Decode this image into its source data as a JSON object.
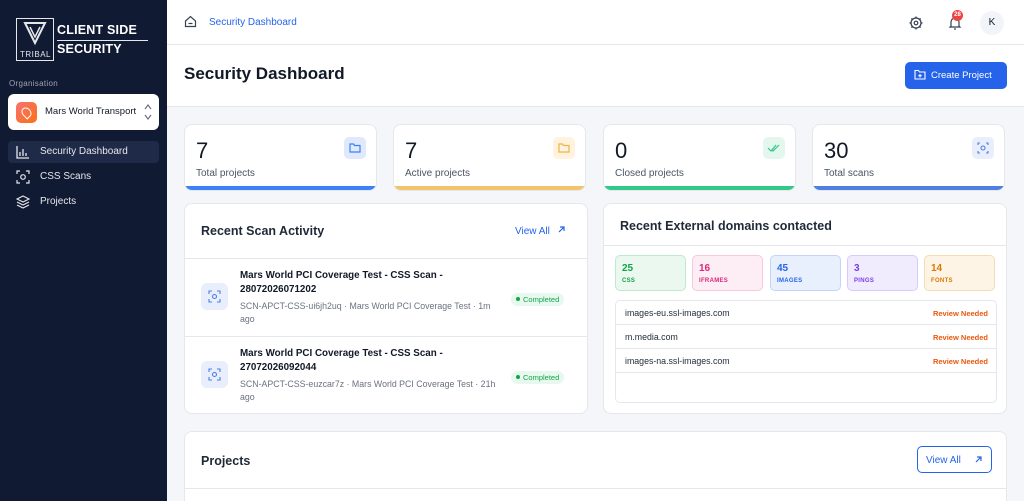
{
  "brand": {
    "line1": "CLIENT SIDE",
    "line2": "SECURITY",
    "tag": "TRIBAL"
  },
  "org": {
    "label": "Organisation",
    "name": "Mars World Transport"
  },
  "nav": [
    {
      "label": "Security Dashboard",
      "icon": "bar-chart-icon",
      "active": true
    },
    {
      "label": "CSS Scans",
      "icon": "scan-icon",
      "active": false
    },
    {
      "label": "Projects",
      "icon": "layers-icon",
      "active": false
    }
  ],
  "topbar": {
    "breadcrumb": "Security Dashboard",
    "notifications": "28",
    "user_initial": "K"
  },
  "header": {
    "title": "Security Dashboard",
    "create_label": "Create Project"
  },
  "stats": [
    {
      "value": "7",
      "label": "Total projects",
      "color": "#3b82f6",
      "icon_bg": "#e0e9fb",
      "icon": "folder-icon"
    },
    {
      "value": "7",
      "label": "Active projects",
      "color": "#f2c46b",
      "icon_bg": "#fff3de",
      "icon": "folder-icon"
    },
    {
      "value": "0",
      "label": "Closed projects",
      "color": "#34c78a",
      "icon_bg": "#e3f7ee",
      "icon": "double-check-icon"
    },
    {
      "value": "30",
      "label": "Total scans",
      "color": "#4f7fe0",
      "icon_bg": "#e8eefc",
      "icon": "scan-icon"
    }
  ],
  "recent_scans": {
    "title": "Recent Scan Activity",
    "view_all": "View All",
    "items": [
      {
        "title": "Mars World PCI Coverage Test - CSS Scan - 28072026071202",
        "meta": "SCN-APCT-CSS-ui6jh2uq · Mars World PCI Coverage Test · 1m ago",
        "status": "Completed"
      },
      {
        "title": "Mars World PCI Coverage Test - CSS Scan - 27072026092044",
        "meta": "SCN-APCT-CSS-euzcar7z · Mars World PCI Coverage Test · 21h ago",
        "status": "Completed"
      }
    ]
  },
  "domains": {
    "title": "Recent External domains contacted",
    "tiles": [
      {
        "value": "25",
        "label": "CSS",
        "fg": "#16a34a",
        "bg": "#eaf8ef",
        "border": "#bfe9cf"
      },
      {
        "value": "16",
        "label": "IFRAMES",
        "fg": "#db2777",
        "bg": "#fdeef5",
        "border": "#f6c9dc"
      },
      {
        "value": "45",
        "label": "IMAGES",
        "fg": "#2563eb",
        "bg": "#e9f0fd",
        "border": "#c3d5f7"
      },
      {
        "value": "3",
        "label": "PINGS",
        "fg": "#7c3aed",
        "bg": "#f1ecfd",
        "border": "#d9cbf7"
      },
      {
        "value": "14",
        "label": "FONTS",
        "fg": "#d97706",
        "bg": "#fdf4e6",
        "border": "#f5dcb3"
      }
    ],
    "rows": [
      {
        "domain": "images-eu.ssl-images.com",
        "status": "Review Needed"
      },
      {
        "domain": "m.media.com",
        "status": "Review Needed"
      },
      {
        "domain": "images-na.ssl-images.com",
        "status": "Review Needed"
      }
    ]
  },
  "projects": {
    "title": "Projects",
    "view_all": "View All"
  }
}
